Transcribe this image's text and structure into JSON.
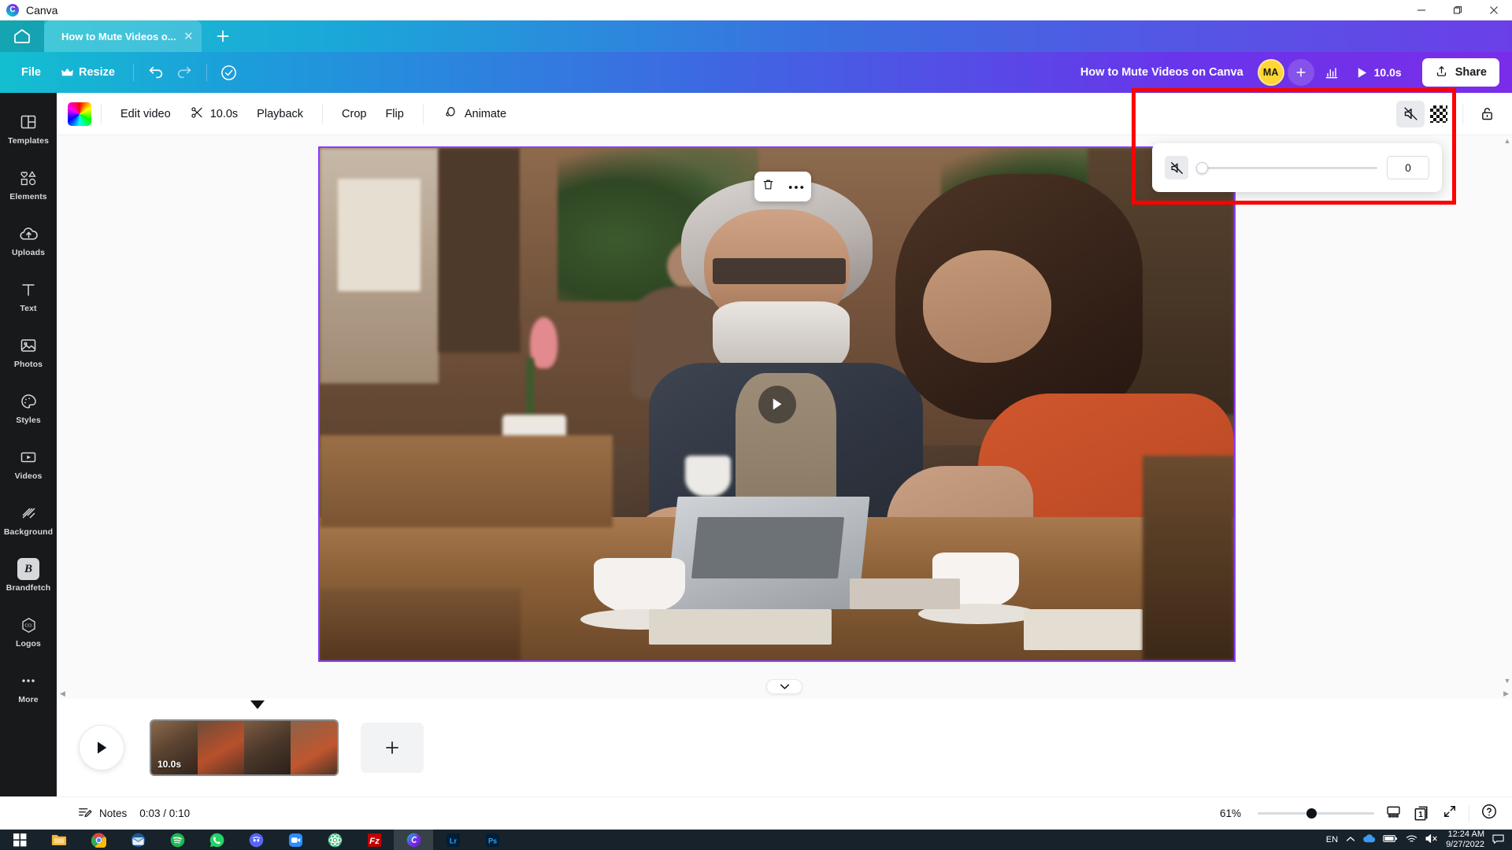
{
  "window": {
    "app_name": "Canva",
    "logo_icon": "canva-logo-icon",
    "minimize_icon": "minimize-icon",
    "maximize_icon": "maximize-icon",
    "close_icon": "close-icon"
  },
  "tabstrip": {
    "home_icon": "home-icon",
    "tab_label": "How to Mute Videos o...",
    "tab_close_icon": "close-icon",
    "new_tab_icon": "plus-icon"
  },
  "header": {
    "file_label": "File",
    "resize_label": "Resize",
    "crown_icon": "crown-icon",
    "undo_icon": "undo-icon",
    "redo_icon": "redo-icon",
    "cloud_saved_icon": "cloud-check-icon",
    "doc_title": "How to Mute Videos on Canva",
    "avatar_initials": "MA",
    "add_people_icon": "plus-icon",
    "insights_icon": "bar-chart-icon",
    "play_icon": "play-icon",
    "duration": "10.0s",
    "share_label": "Share",
    "share_icon": "upload-icon"
  },
  "sidebar": {
    "items": [
      {
        "label": "Templates",
        "icon": "templates-icon"
      },
      {
        "label": "Elements",
        "icon": "elements-icon"
      },
      {
        "label": "Uploads",
        "icon": "uploads-icon"
      },
      {
        "label": "Text",
        "icon": "text-icon"
      },
      {
        "label": "Photos",
        "icon": "photos-icon"
      },
      {
        "label": "Styles",
        "icon": "styles-icon"
      },
      {
        "label": "Videos",
        "icon": "videos-icon"
      },
      {
        "label": "Background",
        "icon": "background-icon"
      },
      {
        "label": "Brandfetch",
        "icon": "brandfetch-icon"
      },
      {
        "label": "Logos",
        "icon": "logos-icon"
      },
      {
        "label": "More",
        "icon": "more-dots-icon"
      }
    ],
    "brandfetch_glyph": "B"
  },
  "toolbar": {
    "color_swatch_icon": "color-swatch-icon",
    "edit_video_label": "Edit video",
    "scissors_icon": "scissors-icon",
    "duration_label": "10.0s",
    "playback_label": "Playback",
    "crop_label": "Crop",
    "flip_label": "Flip",
    "animate_label": "Animate",
    "animate_icon": "animate-icon",
    "volume_icon": "volume-mute-icon",
    "transparency_icon": "transparency-checker-icon",
    "lock_icon": "unlock-icon"
  },
  "canvas": {
    "delete_icon": "trash-icon",
    "more_icon": "more-dots-icon",
    "play_overlay_icon": "play-icon",
    "collapse_icon": "chevron-down-icon"
  },
  "volume_panel": {
    "mute_icon": "volume-mute-icon",
    "value": "0",
    "slider_position_percent": 0
  },
  "timeline": {
    "play_icon": "play-icon",
    "clip_duration": "10.0s",
    "add_page_icon": "plus-icon"
  },
  "statusbar": {
    "notes_label": "Notes",
    "notes_icon": "notes-icon",
    "time_display": "0:03 / 0:10",
    "zoom_level": "61%",
    "zoom_slider_percent": 42,
    "present_icon": "present-icon",
    "page_count": "1",
    "pages_icon": "pages-icon",
    "fullscreen_icon": "expand-icon",
    "help_icon": "help-icon"
  },
  "taskbar": {
    "items": [
      {
        "name": "start-button",
        "icon": "windows-icon"
      },
      {
        "name": "file-explorer",
        "icon": "folder-icon"
      },
      {
        "name": "google-chrome",
        "icon": "chrome-icon"
      },
      {
        "name": "mail-client",
        "icon": "mail-icon"
      },
      {
        "name": "spotify",
        "icon": "spotify-icon"
      },
      {
        "name": "whatsapp",
        "icon": "whatsapp-icon"
      },
      {
        "name": "discord",
        "icon": "discord-icon"
      },
      {
        "name": "zoom",
        "icon": "video-camera-icon"
      },
      {
        "name": "atom-editor",
        "icon": "atom-icon"
      },
      {
        "name": "filezilla",
        "icon": "filezilla-icon"
      },
      {
        "name": "canva",
        "icon": "canva-icon"
      },
      {
        "name": "lightroom",
        "icon": "lightroom-icon"
      },
      {
        "name": "photoshop",
        "icon": "photoshop-icon"
      }
    ],
    "tray": {
      "language": "EN",
      "chevron_icon": "chevron-up-icon",
      "cloud_icon": "onedrive-icon",
      "battery_icon": "battery-icon",
      "wifi_icon": "wifi-icon",
      "volume_icon": "volume-mute-icon",
      "time": "12:24 AM",
      "date": "9/27/2022",
      "notifications_icon": "notification-icon"
    }
  },
  "colors": {
    "brand_gradient_start": "#14bfd0",
    "brand_gradient_end": "#7a2de8",
    "accent_purple": "#8b3dff",
    "highlight_red": "#ff0000",
    "avatar_yellow": "#ffd633",
    "sidebar_dark": "#18191b"
  }
}
